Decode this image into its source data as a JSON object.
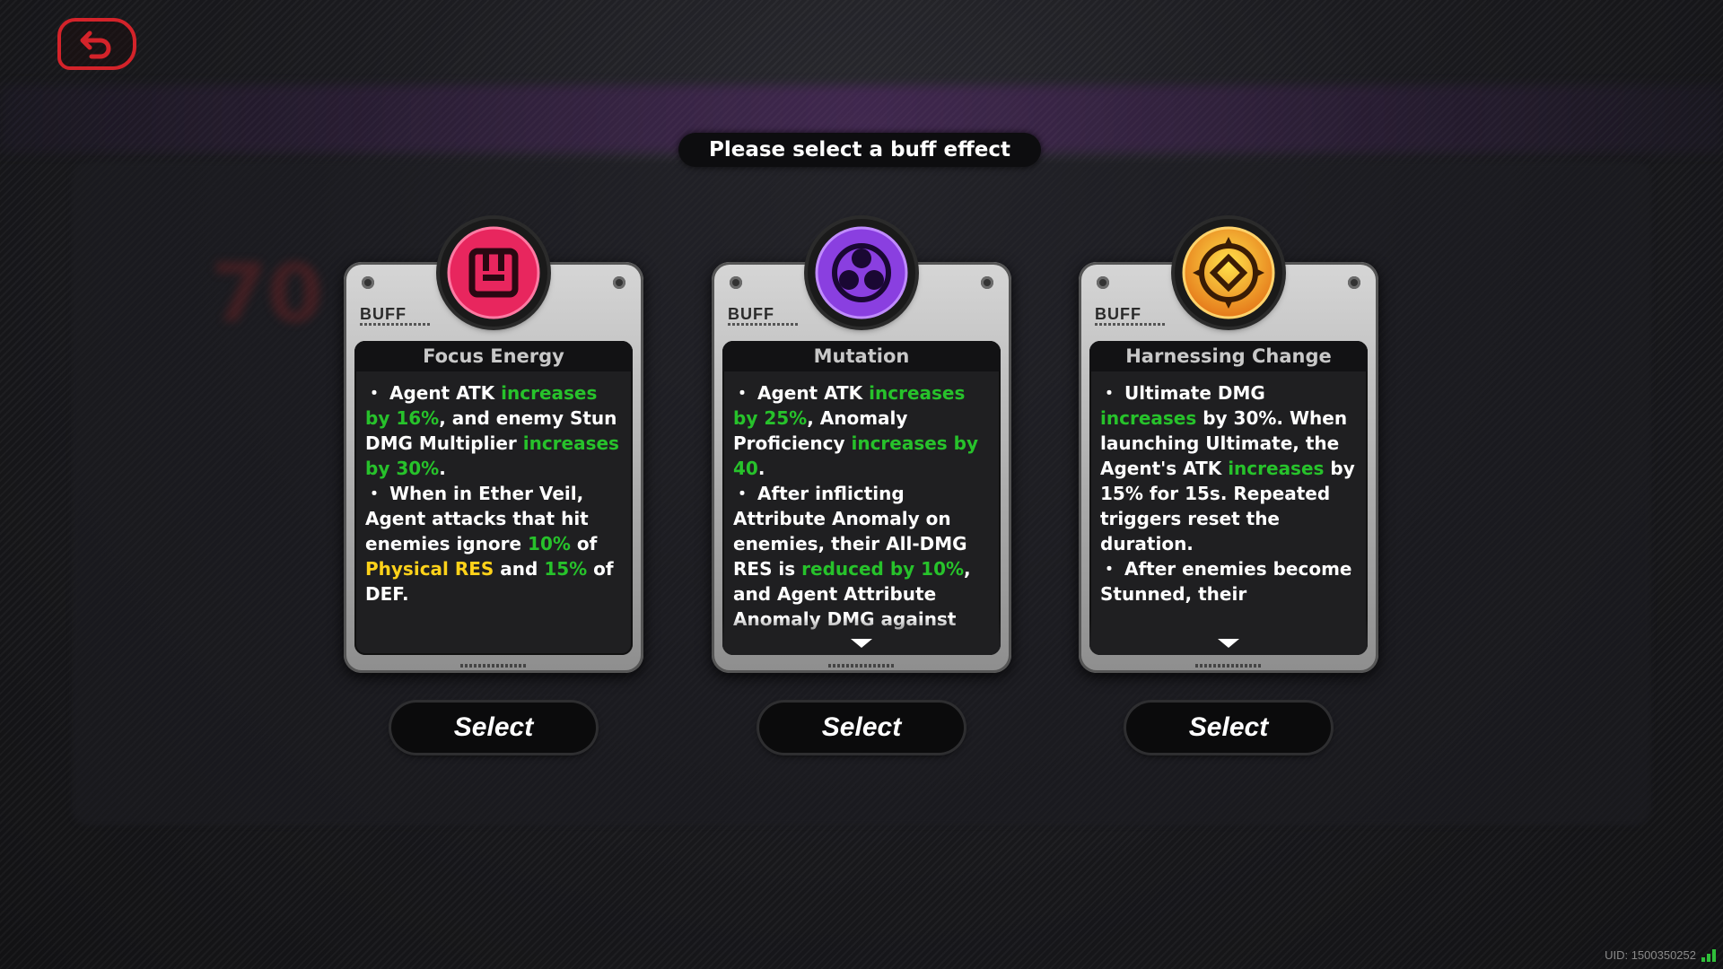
{
  "header": {
    "prompt": "Please select a buff effect"
  },
  "background": {
    "blurred_number": "70"
  },
  "cards": [
    {
      "tag": "BUFF",
      "title": "Focus Energy",
      "emblem_icon": "grid-square-emblem",
      "emblem_color": "#e8265e",
      "lines": [
        [
          {
            "t": "・ Agent ATK "
          },
          {
            "t": "increases by 16%",
            "c": "g"
          },
          {
            "t": ", and enemy Stun DMG Multiplier "
          },
          {
            "t": "increases by 30%",
            "c": "g"
          },
          {
            "t": "."
          }
        ],
        [
          {
            "t": "・ When in Ether Veil, Agent attacks that hit enemies ignore "
          },
          {
            "t": "10%",
            "c": "g"
          },
          {
            "t": " of "
          },
          {
            "t": "Physical RES",
            "c": "y"
          },
          {
            "t": " and "
          },
          {
            "t": "15%",
            "c": "g"
          },
          {
            "t": " of DEF."
          }
        ]
      ],
      "select_label": "Select"
    },
    {
      "tag": "BUFF",
      "title": "Mutation",
      "emblem_icon": "trefoil-emblem",
      "emblem_color": "#8a3fe0",
      "lines": [
        [
          {
            "t": "・ Agent ATK "
          },
          {
            "t": "increases by 25%",
            "c": "g"
          },
          {
            "t": ", Anomaly Proficiency "
          },
          {
            "t": "increases by 40",
            "c": "g"
          },
          {
            "t": "."
          }
        ],
        [
          {
            "t": "・ After inflicting Attribute Anomaly on enemies, their All-DMG RES is "
          },
          {
            "t": "reduced by 10%",
            "c": "g"
          },
          {
            "t": ", and Agent Attribute Anomaly DMG against"
          }
        ]
      ],
      "select_label": "Select"
    },
    {
      "tag": "BUFF",
      "title": "Harnessing Change",
      "emblem_icon": "gear-emblem",
      "emblem_color": "#f0a11a",
      "lines": [
        [
          {
            "t": "・ Ultimate DMG "
          },
          {
            "t": "increases",
            "c": "g"
          },
          {
            "t": " by 30%. When launching Ultimate, the Agent's ATK "
          },
          {
            "t": "increases",
            "c": "g"
          },
          {
            "t": " by 15% for 15s. Repeated triggers reset the duration."
          }
        ],
        [
          {
            "t": "・ After enemies become Stunned, their"
          }
        ]
      ],
      "select_label": "Select"
    }
  ],
  "footer": {
    "uid": "UID: 1500350252"
  }
}
